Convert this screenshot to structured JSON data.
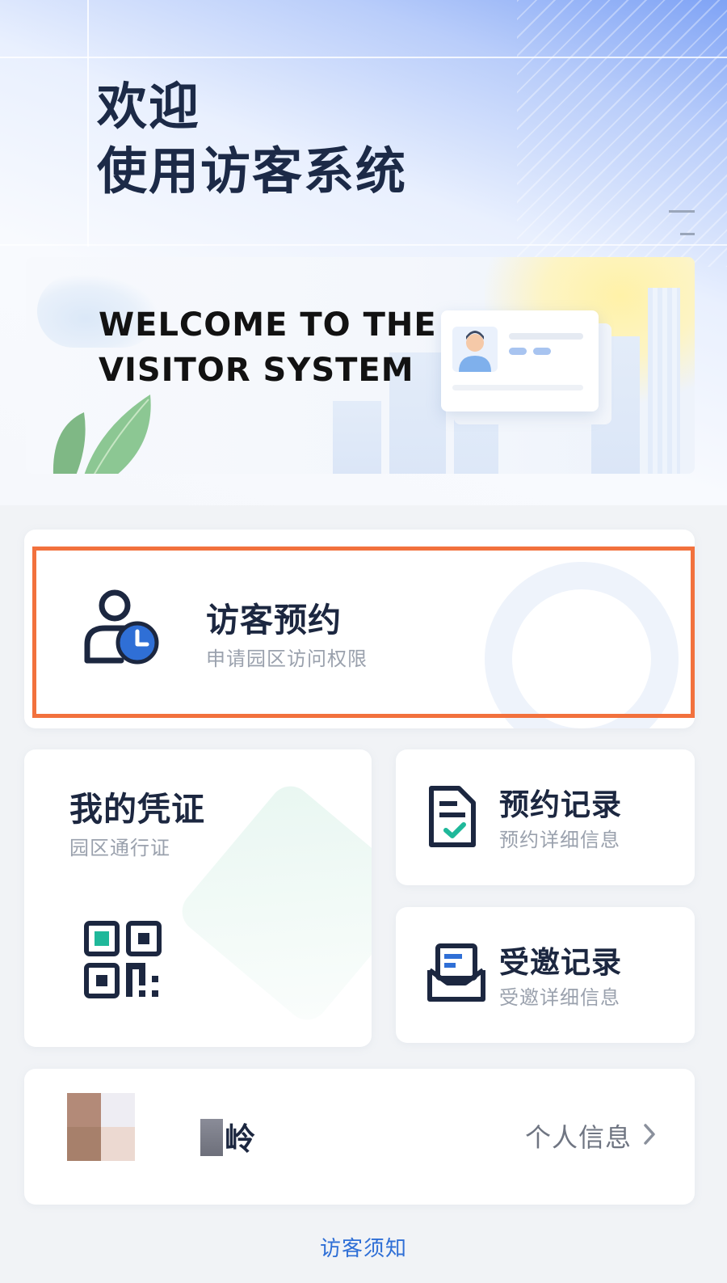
{
  "header": {
    "title_line1": "欢迎",
    "title_line2": "使用访客系统"
  },
  "banner": {
    "line1": "WELCOME TO THE",
    "line2": "VISITOR SYSTEM",
    "illustration_icon": "id-card-icon"
  },
  "appointment": {
    "title": "访客预约",
    "subtitle": "申请园区访问权限",
    "icon": "user-clock-icon",
    "highlight_color": "#f2713d"
  },
  "credential": {
    "title": "我的凭证",
    "subtitle": "园区通行证",
    "icon": "qr-code-icon"
  },
  "records": {
    "title": "预约记录",
    "subtitle": "预约详细信息",
    "icon": "document-check-icon"
  },
  "invites": {
    "title": "受邀记录",
    "subtitle": "受邀详细信息",
    "icon": "envelope-icon"
  },
  "profile": {
    "name": "岭",
    "link_label": "个人信息",
    "link_icon": "chevron-right-icon"
  },
  "footer": {
    "notice_link": "访客须知"
  },
  "colors": {
    "primary_dark": "#1c2740",
    "accent_blue": "#2f6fd6",
    "accent_teal": "#1fb89a"
  }
}
